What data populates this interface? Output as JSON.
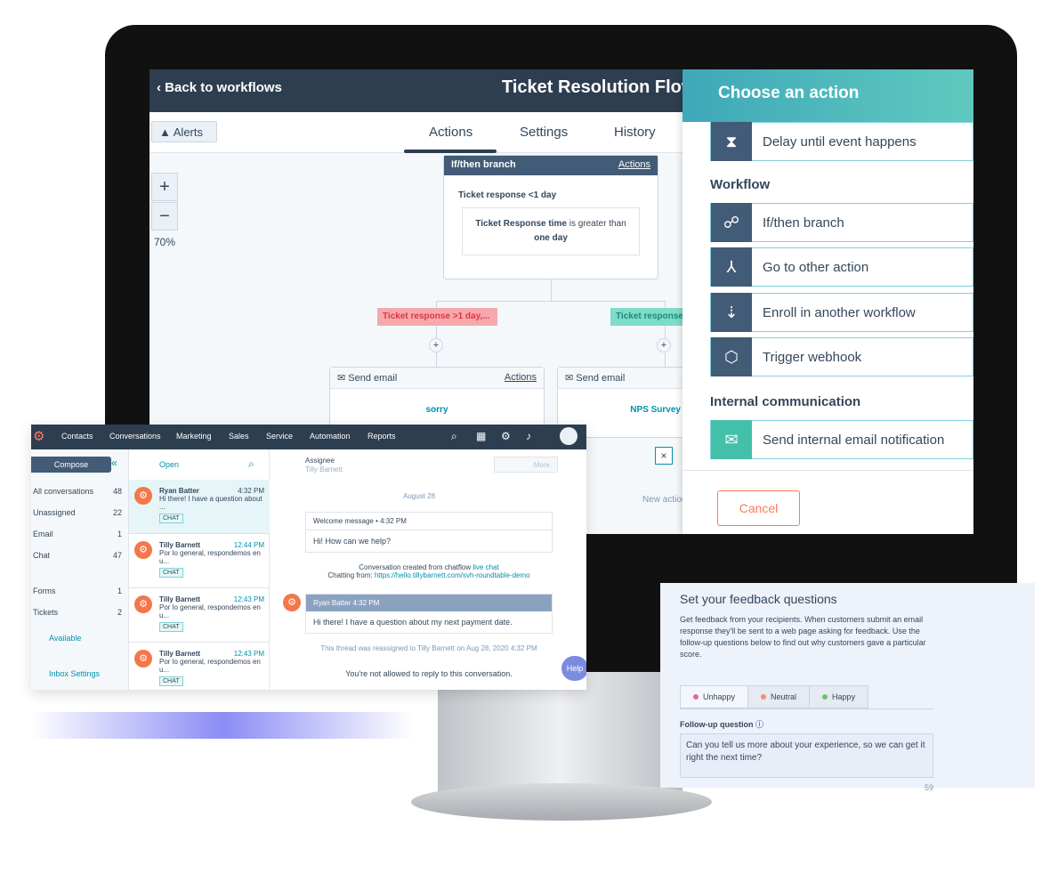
{
  "workflow": {
    "back_label": "Back to workflows",
    "title": "Ticket Resolution Flow",
    "alerts_label": "Alerts",
    "tabs": [
      "Actions",
      "Settings",
      "History"
    ],
    "active_tab": "Actions",
    "zoom_in": "+",
    "zoom_out": "−",
    "zoom_level": "70%",
    "branch": {
      "header": "If/then branch",
      "actions": "Actions",
      "name": "Ticket response <1 day",
      "cond_bold": "Ticket Response time",
      "cond_text": " is greater than ",
      "cond_value": "one day"
    },
    "branch_left": "Ticket response >1 day,...",
    "branch_right": "Ticket response",
    "email_left": {
      "header": "Send email",
      "actions": "Actions",
      "link": "sorry"
    },
    "email_right": {
      "header": "Send email",
      "link": "NPS Survey"
    },
    "new_action": "New action"
  },
  "panel": {
    "title": "Choose an action",
    "items_top": [
      {
        "label": "Delay until event happens",
        "icon": "hourglass-icon"
      }
    ],
    "section_workflow": "Workflow",
    "workflow_items": [
      {
        "label": "If/then branch",
        "icon": "branch-icon"
      },
      {
        "label": "Go to other action",
        "icon": "merge-arrow-icon"
      },
      {
        "label": "Enroll in another workflow",
        "icon": "enroll-icon"
      },
      {
        "label": "Trigger webhook",
        "icon": "cube-icon"
      }
    ],
    "section_internal": "Internal communication",
    "internal_items": [
      {
        "label": "Send internal email notification",
        "icon": "envelope-icon"
      }
    ],
    "cancel": "Cancel",
    "accent": "#ff7a59"
  },
  "inbox": {
    "nav": [
      "Contacts",
      "Conversations",
      "Marketing",
      "Sales",
      "Service",
      "Automation",
      "Reports"
    ],
    "compose": "Compose",
    "folders": [
      {
        "label": "All conversations",
        "count": "48"
      },
      {
        "label": "Unassigned",
        "count": "22"
      },
      {
        "label": "Email",
        "count": "1"
      },
      {
        "label": "Chat",
        "count": "47"
      },
      {
        "label": "Forms",
        "count": "1"
      },
      {
        "label": "Tickets",
        "count": "2"
      }
    ],
    "status": "Available",
    "settings": "Inbox Settings",
    "filter": "Open",
    "conversations": [
      {
        "name": "Ryan Batter",
        "time": "4:32 PM",
        "preview": "Hi there! I have a question about ...",
        "tag": "CHAT"
      },
      {
        "name": "Tilly Barnett",
        "time": "12:44 PM",
        "preview": "Por lo general, respondemos en u...",
        "tag": "CHAT"
      },
      {
        "name": "Tilly Barnett",
        "time": "12:43 PM",
        "preview": "Por lo general, respondemos en u...",
        "tag": "CHAT"
      },
      {
        "name": "Tilly Barnett",
        "time": "12:43 PM",
        "preview": "Por lo general, respondemos en u...",
        "tag": "CHAT"
      }
    ],
    "assignee_label": "Assignee",
    "assignee": "Tilly Barnett",
    "more": "More",
    "date": "August 28",
    "welcome_header": "Welcome message • 4:32 PM",
    "welcome_body": "Hi! How can we help?",
    "created_text": "Conversation created from chatflow ",
    "created_link": "live chat",
    "chatting_text": "Chatting from: ",
    "chatting_link": "https://hello.tillybarnett.com/svh-roundtable-demo",
    "msg_header": "Ryan Batter   4:32 PM",
    "msg_body": "Hi there! I have a question about my next payment date.",
    "reassigned": "This thread was reassigned to Tilly Barnett on Aug 28, 2020 4:32 PM",
    "no_reply": "You're not allowed to reply to this conversation.",
    "help": "Help"
  },
  "feedback": {
    "title": "Set your feedback questions",
    "description": "Get feedback from your recipients. When customers submit an email response they'll be sent to a web page asking for feedback. Use the follow-up questions below to find out why customers gave a particular score.",
    "tabs": [
      {
        "label": "Unhappy",
        "color": "#e06a9a"
      },
      {
        "label": "Neutral",
        "color": "#f2906f"
      },
      {
        "label": "Happy",
        "color": "#6fc36f"
      }
    ],
    "followup_label": "Follow-up question",
    "followup_value": "Can you tell us more about your experience, so we can get it right the next time?",
    "char_count": "59"
  }
}
